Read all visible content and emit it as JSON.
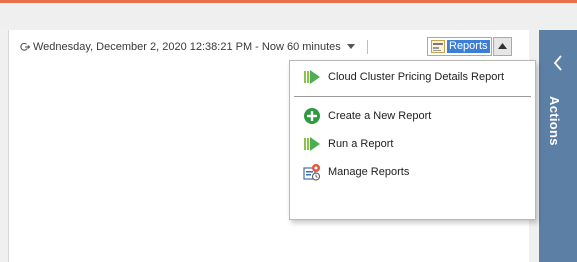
{
  "header": {
    "time_range": "Wednesday, December 2, 2020 12:38:21 PM - Now 60 minutes",
    "reports_label": "Reports"
  },
  "reports_menu": {
    "items": [
      {
        "label": "Cloud Cluster Pricing Details Report",
        "icon": "run-report-icon"
      },
      {
        "label": "Create a New Report",
        "icon": "add-circle-icon"
      },
      {
        "label": "Run a Report",
        "icon": "run-report-icon"
      },
      {
        "label": "Manage Reports",
        "icon": "manage-reports-icon"
      }
    ]
  },
  "actions_panel": {
    "label": "Actions",
    "icon": "chevron-left-icon"
  },
  "colors": {
    "accent": "#e8704a",
    "actions_panel": "#5c7fa6",
    "selection": "#3c7fd8",
    "add_icon": "#2e9a3e"
  }
}
